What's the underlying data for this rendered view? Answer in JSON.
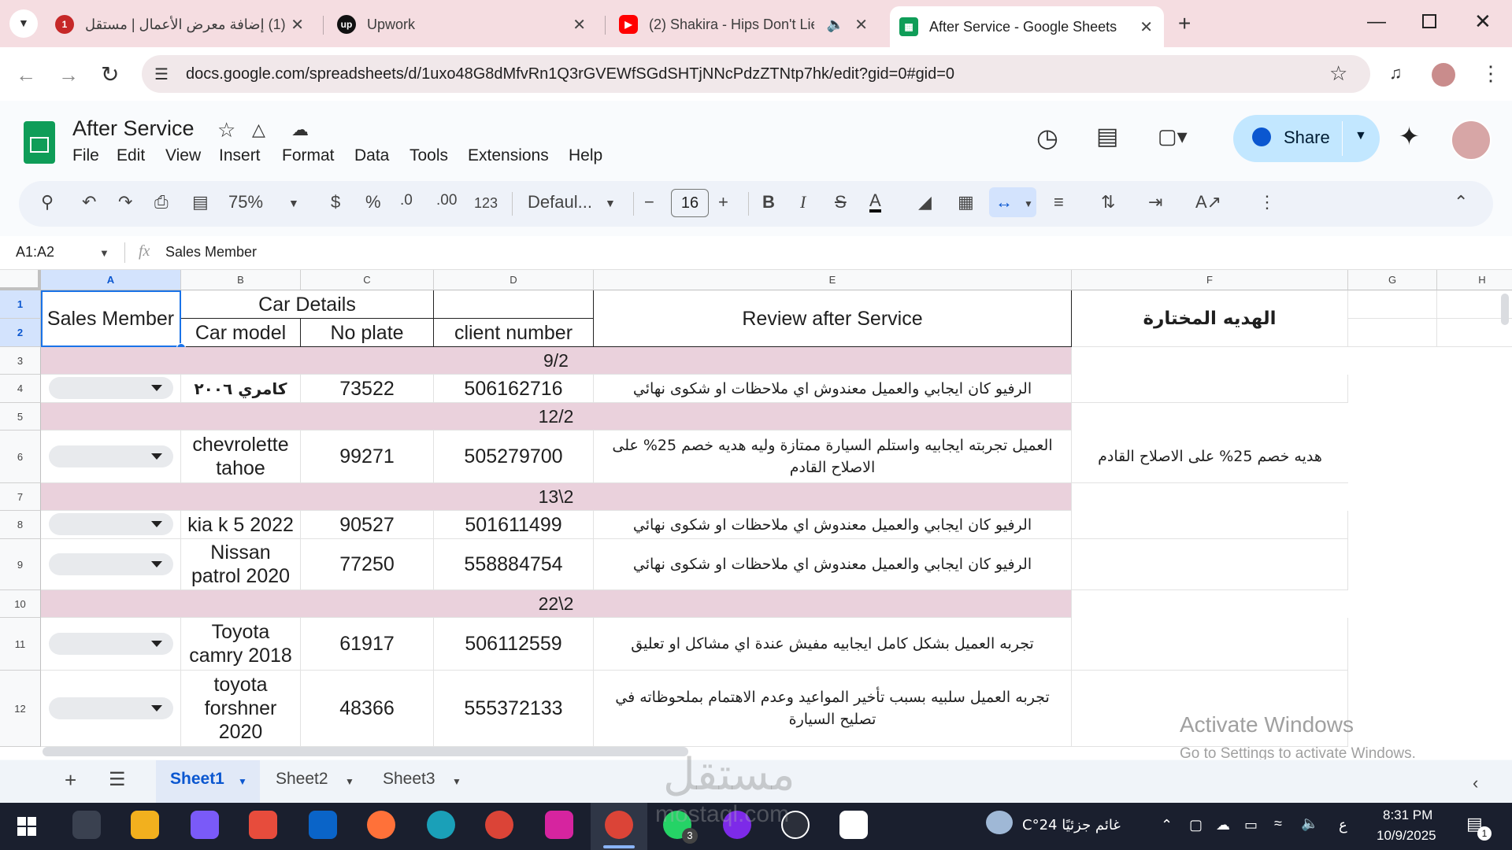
{
  "browser": {
    "tabs": [
      {
        "title": "(1) إضافة معرض الأعمال | مستقل",
        "favicon": "mostaql-icon"
      },
      {
        "title": "Upwork",
        "favicon": "upwork-icon"
      },
      {
        "title": "(2) Shakira - Hips Don't Lie",
        "favicon": "youtube-icon"
      },
      {
        "title": "After Service - Google Sheets",
        "favicon": "sheets-icon"
      }
    ],
    "url": "docs.google.com/spreadsheets/d/1uxo48G8dMfvRn1Q3rGVEWfSGdSHTjNNcPdzZTNtp7hk/edit?gid=0#gid=0"
  },
  "sheets": {
    "doc_title": "After Service",
    "menu": [
      "File",
      "Edit",
      "View",
      "Insert",
      "Format",
      "Data",
      "Tools",
      "Extensions",
      "Help"
    ],
    "share_label": "Share",
    "toolbar": {
      "zoom": "75%",
      "currency": "$",
      "percent": "%",
      "dec_down": ".0",
      "dec_up": ".00",
      "number_format": "123",
      "font": "Defaul...",
      "font_size": "16"
    },
    "name_box": "A1:A2",
    "formula": "Sales Member"
  },
  "grid": {
    "columns": [
      "A",
      "B",
      "C",
      "D",
      "E",
      "F",
      "G",
      "H"
    ],
    "rows": [
      "1",
      "2",
      "3",
      "4",
      "5",
      "6",
      "7",
      "8",
      "9",
      "10",
      "11",
      "12"
    ],
    "header": {
      "sales_member": "Sales Member",
      "car_details": "Car Details",
      "car_model": "Car model",
      "no_plate": "No plate",
      "client_number": "client number",
      "review": "Review after Service",
      "gift": "الهديه المختارة"
    },
    "dates": {
      "r3": "9/2",
      "r5": "12/2",
      "r7": "13\\2",
      "r10": "22\\2"
    },
    "records": [
      {
        "row": "4",
        "model": "كامري ٢٠٠٦",
        "plate": "73522",
        "client": "506162716",
        "review": "الرفيو كان ايجابي والعميل معندوش اي ملاحظات او شكوى نهائي",
        "gift": ""
      },
      {
        "row": "6",
        "model": "chevrolette tahoe",
        "plate": "99271",
        "client": "505279700",
        "review": "العميل تجربته ايجابيه واستلم السيارة ممتازة وليه هديه خصم 25% على الاصلاح القادم",
        "gift": "هديه خصم 25% على الاصلاح القادم"
      },
      {
        "row": "8",
        "model": "kia k 5 2022",
        "plate": "90527",
        "client": "501611499",
        "review": "الرفيو كان ايجابي والعميل معندوش اي ملاحظات او شكوى نهائي",
        "gift": ""
      },
      {
        "row": "9",
        "model": "Nissan patrol 2020",
        "plate": "77250",
        "client": "558884754",
        "review": "الرفيو كان ايجابي والعميل معندوش اي ملاحظات او شكوى نهائي",
        "gift": ""
      },
      {
        "row": "11",
        "model": "Toyota camry 2018",
        "plate": "61917",
        "client": "506112559",
        "review": "تجربه العميل بشكل كامل ايجابيه مفيش عندة اي مشاكل او تعليق",
        "gift": ""
      },
      {
        "row": "12",
        "model": "toyota forshner 2020",
        "plate": "48366",
        "client": "555372133",
        "review": "تجربه العميل سلبيه بسبب تأخير المواعيد وعدم الاهتمام بملحوظاته في تصليح السيارة",
        "gift": ""
      }
    ]
  },
  "sheet_tabs": [
    "Sheet1",
    "Sheet2",
    "Sheet3"
  ],
  "overlay": {
    "activate_title": "Activate Windows",
    "activate_sub": "Go to Settings to activate Windows.",
    "watermark": "مستقل",
    "watermark_sub": "mostaql.com"
  },
  "taskbar": {
    "weather": "غائم جزئيًا  24°C",
    "lang": "ع",
    "time": "8:31 PM",
    "date": "10/9/2025",
    "whatsapp_badge": "3",
    "notif_badge": "1"
  },
  "colors": {
    "accent": "#0b57d0",
    "tab_strip": "#f5dde1",
    "date_row": "#ead1dc",
    "share": "#c2e7ff"
  }
}
